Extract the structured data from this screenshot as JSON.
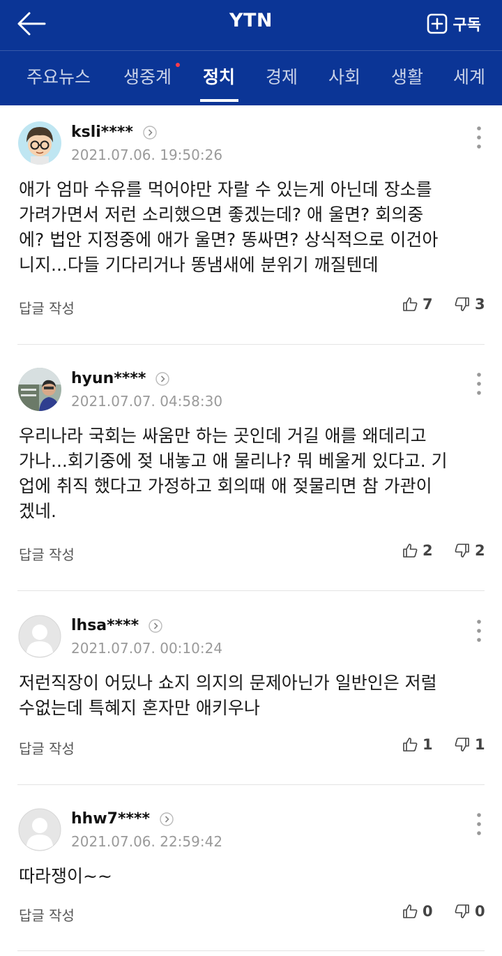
{
  "header": {
    "title": "YTN",
    "subscribe_label": "구독"
  },
  "tabs": [
    {
      "label": "주요뉴스"
    },
    {
      "label": "생중계"
    },
    {
      "label": "정치"
    },
    {
      "label": "경제"
    },
    {
      "label": "사회"
    },
    {
      "label": "생활"
    },
    {
      "label": "세계"
    }
  ],
  "active_tab": "정치",
  "colors": {
    "brand": "#0b3596",
    "new_dot": "#ff3b4a"
  },
  "comments": [
    {
      "user": "ksli****",
      "date": "2021.07.06. 19:50:26",
      "lines": [
        "애가 엄마 수유를 먹어야만 자랄 수 있는게 아닌데 장소를",
        "가려가면서 저런 소리했으면 좋겠는데? 애 울면? 회의중",
        "에? 법안 지정중에 애가 울면? 똥싸면? 상식적으로 이건아",
        "니지...다들 기다리거나 똥냄새에 분위기 깨질텐데"
      ],
      "reply_label": "답글 작성",
      "likes": "7",
      "dislikes": "3"
    },
    {
      "user": "hyun****",
      "date": "2021.07.07. 04:58:30",
      "lines": [
        "우리나라 국회는 싸움만 하는 곳인데 거길 애를 왜데리고",
        "가나...회기중에 젖 내놓고 애 물리나? 뭐 베울게 있다고. 기",
        "업에 취직 했다고 가정하고 회의때 애 젖물리면 참 가관이",
        "겠네."
      ],
      "reply_label": "답글 작성",
      "likes": "2",
      "dislikes": "2"
    },
    {
      "user": "lhsa****",
      "date": "2021.07.07. 00:10:24",
      "lines": [
        "저런직장이 어딨나 쇼지 의지의 문제아닌가 일반인은 저럴",
        "수없는데 특혜지 혼자만 애키우나"
      ],
      "reply_label": "답글 작성",
      "likes": "1",
      "dislikes": "1"
    },
    {
      "user": "hhw7****",
      "date": "2021.07.06. 22:59:42",
      "lines": [
        "따라쟁이~~"
      ],
      "reply_label": "답글 작성",
      "likes": "0",
      "dislikes": "0"
    }
  ]
}
